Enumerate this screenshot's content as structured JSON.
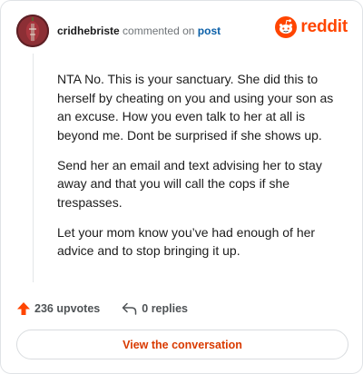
{
  "comment": {
    "username": "cridhebriste",
    "commented_text": "commented on",
    "post_link": "post",
    "paragraphs": [
      "NTA No. This is your sanctuary. She did this to herself by cheating on you and using your son as an excuse. How you even talk to her at all is beyond me. Dont be surprised if she shows up.",
      "Send her an email and text advising her to stay away and that you will call the cops if she trespasses.",
      "Let your mom know you’ve had enough of her advice and to stop bringing it up."
    ]
  },
  "brand": {
    "name": "reddit",
    "color": "#ff4500"
  },
  "actions": {
    "upvotes_label": "236 upvotes",
    "replies_label": "0 replies"
  },
  "cta": {
    "label": "View the conversation",
    "color": "#d93a00"
  },
  "icons": {
    "upvote": "upvote-arrow-icon",
    "reply": "reply-arrow-icon",
    "logo": "reddit-snoo-icon"
  }
}
